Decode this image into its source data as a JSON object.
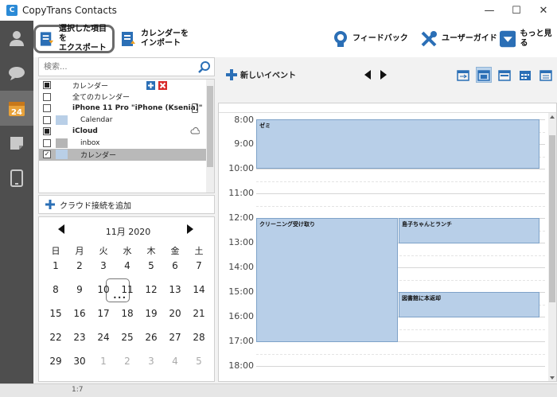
{
  "window": {
    "title": "CopyTrans Contacts",
    "minimize": "—",
    "maximize": "☐",
    "close": "✕"
  },
  "toolbar": {
    "export_label_1": "選択した項目を",
    "export_label_2": "エクスポート",
    "import_label_1": "カレンダーを",
    "import_label_2": "インポート",
    "feedback_label": "フィードバック",
    "guide_label": "ユーザーガイド",
    "more_label": "もっと見る"
  },
  "search": {
    "placeholder": "検索..."
  },
  "calendars": [
    {
      "label": "カレンダー",
      "check": "partial"
    },
    {
      "label": "全てのカレンダー",
      "check": "none"
    },
    {
      "label": "iPhone 11 Pro \"iPhone (Ksenia)\"",
      "check": "none",
      "bold": true
    },
    {
      "label": "Calendar",
      "check": "none",
      "color": "#b9cfe7"
    },
    {
      "label": "iCloud",
      "check": "partial",
      "bold": true
    },
    {
      "label": "inbox",
      "check": "none",
      "color": "#b5b5b5"
    },
    {
      "label": "カレンダー",
      "check": "checked",
      "color": "#b9cfe7",
      "selected": true
    }
  ],
  "add_cloud_label": "クラウド接続を追加",
  "mini_calendar": {
    "month_label": "11月 2020",
    "weekdays": [
      "日",
      "月",
      "火",
      "水",
      "木",
      "金",
      "土"
    ],
    "weeks": [
      [
        "1",
        "2",
        "3",
        "4",
        "5",
        "6",
        "7"
      ],
      [
        "8",
        "9",
        "10",
        "11",
        "12",
        "13",
        "14"
      ],
      [
        "15",
        "16",
        "17",
        "18",
        "19",
        "20",
        "21"
      ],
      [
        "22",
        "23",
        "24",
        "25",
        "26",
        "27",
        "28"
      ],
      [
        "29",
        "30",
        "1",
        "2",
        "3",
        "4",
        "5"
      ]
    ],
    "today": "9",
    "today_dots": "•••"
  },
  "calendar_view": {
    "new_event_label": "新しいイベント",
    "hours": [
      "8:00",
      "9:00",
      "10:00",
      "11:00",
      "12:00",
      "13:00",
      "14:00",
      "15:00",
      "16:00",
      "17:00",
      "18:00"
    ],
    "events": [
      {
        "title": "ゼミ"
      },
      {
        "title": "クリーニング受け取り"
      },
      {
        "title": "島子ちゃんとランチ"
      },
      {
        "title": "図書館に本返却"
      }
    ]
  },
  "status": {
    "zoom": "1:7"
  },
  "colors": {
    "accent": "#2b6fb6",
    "event_fill": "#b8cfe8",
    "nav_bg": "#4e4e4e"
  }
}
